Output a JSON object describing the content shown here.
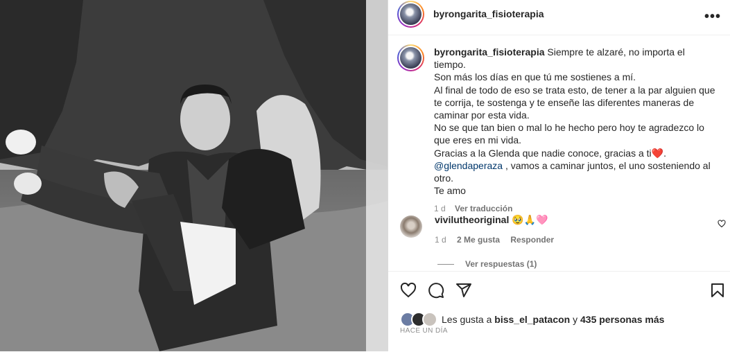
{
  "post": {
    "username": "byrongarita_fisioterapia",
    "more_icon": "more-horizontal-icon"
  },
  "caption": {
    "username": "byrongarita_fisioterapia",
    "line1": "Siempre te alzaré, no importa el tiempo.",
    "line2": "Son más los días en que tú me sostienes a mí.",
    "line3": "Al final de todo de eso se trata esto, de tener a la par alguien que te corrija, te sostenga y te enseñe las diferentes maneras de caminar por esta vida.",
    "line4": "No se que tan bien o mal lo he hecho pero hoy te agradezco lo que eres en mi vida.",
    "line5": "Gracias a la Glenda que nadie conoce, gracias a ti❤️.",
    "mention": "@glendaperaza",
    "line6": ", vamos a caminar juntos, el uno sosteniendo al otro.",
    "line7": "Te amo",
    "time": "1 d",
    "translate": "Ver traducción"
  },
  "comment": {
    "username": "vivilutheoriginal",
    "text": "🥹🙏🩷",
    "time": "1 d",
    "likes": "2 Me gusta",
    "reply": "Responder",
    "view_replies": "Ver respuestas (1)"
  },
  "footer": {
    "likes_prefix": "Les gusta a",
    "liker": "biss_el_patacon",
    "likes_join": "y",
    "likes_count": "435 personas más",
    "timestamp": "HACE UN DÍA"
  }
}
